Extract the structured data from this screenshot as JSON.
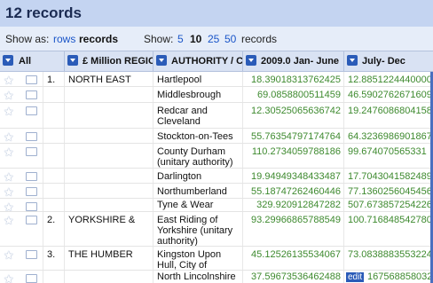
{
  "title": "12 records",
  "show_as": {
    "label": "Show as:",
    "rows": "rows",
    "records": "records",
    "show_label": "Show:",
    "counts": [
      "5",
      "10",
      "25",
      "50"
    ],
    "records_suffix": "records"
  },
  "columns": {
    "all": "All",
    "region": "£ Million REGIO",
    "authority": "AUTHORITY / C",
    "jan_june": "2009.0 Jan- June",
    "july_dec": "July- Dec"
  },
  "rows": [
    {
      "index": "1.",
      "region": "NORTH EAST",
      "authority": "Hartlepool",
      "jan_june": "18.39018313762425",
      "july_dec": "12.8851224440000"
    },
    {
      "index": "",
      "region": "",
      "authority": "Middlesbrough",
      "jan_june": "69.0858800511459",
      "july_dec": "46.5902762671609"
    },
    {
      "index": "",
      "region": "",
      "authority": "Redcar and Cleveland",
      "jan_june": "12.30525065636742",
      "july_dec": "19.2476086804158"
    },
    {
      "index": "",
      "region": "",
      "authority": "Stockton-on-Tees",
      "jan_june": "55.76354797174764",
      "july_dec": "64.3236986901867"
    },
    {
      "index": "",
      "region": "",
      "authority": "County Durham (unitary authority)",
      "jan_june": "110.2734059788186",
      "july_dec": "99.674070565331"
    },
    {
      "index": "",
      "region": "",
      "authority": "Darlington",
      "jan_june": "19.94949348433487",
      "july_dec": "17.7043041582489"
    },
    {
      "index": "",
      "region": "",
      "authority": "Northumberland",
      "jan_june": "55.18747262460446",
      "july_dec": "77.1360256045456"
    },
    {
      "index": "",
      "region": "",
      "authority": "Tyne & Wear",
      "jan_june": "329.920912847282",
      "july_dec": "507.673857254226"
    },
    {
      "index": "2.",
      "region": "YORKSHIRE &",
      "authority": "East Riding of Yorkshire (unitary authority)",
      "jan_june": "93.29966865788549",
      "july_dec": "100.7168485427808"
    },
    {
      "index": "3.",
      "region": "THE HUMBER",
      "authority": "Kingston Upon Hull, City of",
      "jan_june": "45.12526135534067",
      "july_dec": "73.0838883553224"
    },
    {
      "index": "",
      "region": "",
      "authority": "North Lincolnshire",
      "jan_june": "37.59673536462488",
      "july_dec": "167568858032"
    }
  ],
  "edit_label": "edit",
  "colors": {
    "header_bg": "#c4d4f1",
    "showbar_bg": "#e6edf9",
    "link": "#1a55c8",
    "number": "#3e8a2f",
    "accent": "#2a5bb8"
  }
}
